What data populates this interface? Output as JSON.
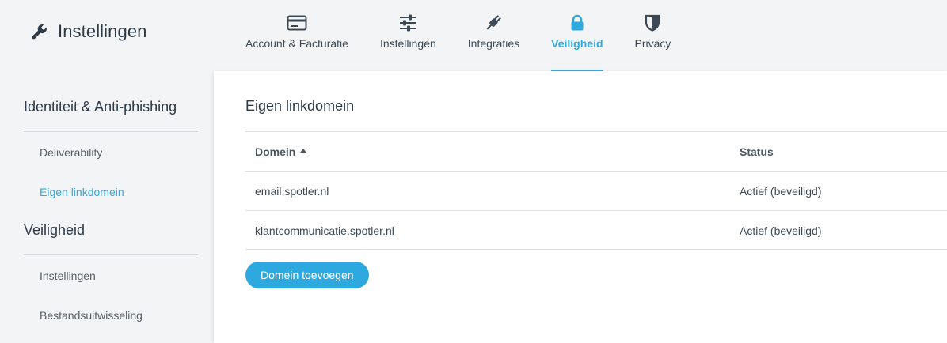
{
  "header": {
    "title": "Instellingen",
    "title_icon": "wrench-icon",
    "tabs": [
      {
        "label": "Account & Facturatie",
        "icon": "credit-card-icon",
        "active": false
      },
      {
        "label": "Instellingen",
        "icon": "sliders-icon",
        "active": false
      },
      {
        "label": "Integraties",
        "icon": "plug-icon",
        "active": false
      },
      {
        "label": "Veiligheid",
        "icon": "lock-icon",
        "active": true
      },
      {
        "label": "Privacy",
        "icon": "shield-icon",
        "active": false
      }
    ]
  },
  "sidebar": {
    "sections": [
      {
        "title": "Identiteit & Anti-phishing",
        "items": [
          {
            "label": "Deliverability",
            "active": false
          },
          {
            "label": "Eigen linkdomein",
            "active": true
          }
        ]
      },
      {
        "title": "Veiligheid",
        "items": [
          {
            "label": "Instellingen",
            "active": false
          },
          {
            "label": "Bestandsuitwisseling",
            "active": false
          }
        ]
      }
    ]
  },
  "main": {
    "title": "Eigen linkdomein",
    "table": {
      "columns": [
        {
          "label": "Domein",
          "sorted": "ascending"
        },
        {
          "label": "Status"
        }
      ],
      "rows": [
        {
          "domain": "email.spotler.nl",
          "status": "Actief (beveiligd)"
        },
        {
          "domain": "klantcommunicatie.spotler.nl",
          "status": "Actief (beveiligd)"
        }
      ]
    },
    "add_button_label": "Domein toevoegen"
  },
  "colors": {
    "accent": "#2ea9df",
    "text_dark": "#2c3a47",
    "background": "#f3f4f5",
    "panel": "#ffffff"
  }
}
